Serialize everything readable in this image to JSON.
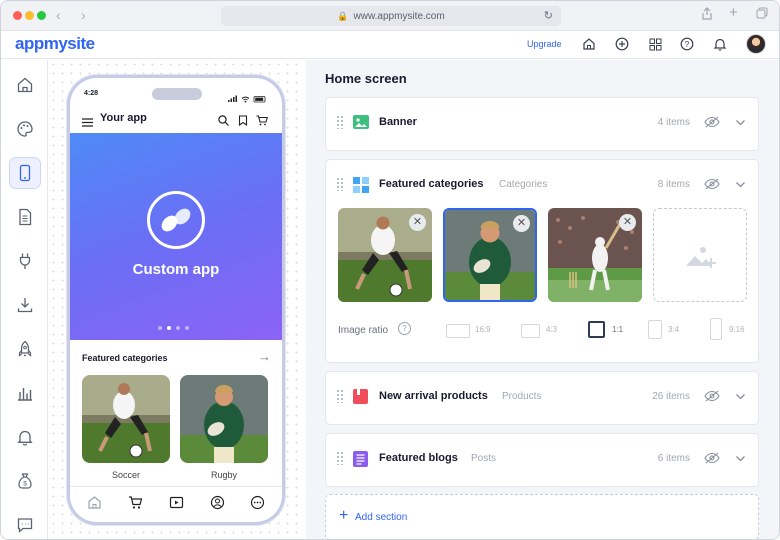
{
  "browser": {
    "url": "www.appmysite.com"
  },
  "appbar": {
    "logo": "appmysite",
    "upgrade_label": "Upgrade",
    "icons": [
      "home-icon",
      "plus-circle-icon",
      "grid-icon",
      "help-icon",
      "bell-icon"
    ]
  },
  "sidebar": {
    "items": [
      "home-icon",
      "palette-icon",
      "phone-icon",
      "document-icon",
      "plug-icon",
      "download-icon",
      "rocket-icon",
      "chart-icon",
      "bell-icon",
      "money-bag-icon",
      "chat-icon"
    ],
    "active_index": 2
  },
  "phone": {
    "time": "4:28",
    "app_title": "Your app",
    "banner_text": "Custom app",
    "section_title": "Featured categories",
    "categories": [
      {
        "label": "Soccer"
      },
      {
        "label": "Rugby"
      }
    ],
    "tabs": [
      "home-icon",
      "cart-icon",
      "play-icon",
      "profile-icon",
      "more-icon"
    ]
  },
  "main": {
    "title": "Home screen",
    "sections": [
      {
        "title": "Banner",
        "subtitle": "",
        "count": "4 items",
        "icon_color": "#3fbf7f"
      },
      {
        "title": "Featured categories",
        "subtitle": "Categories",
        "count": "8 items",
        "icon_color": "#3ea6f2"
      },
      {
        "title": "New arrival products",
        "subtitle": "Products",
        "count": "26 items",
        "icon_color": "#f04d5c"
      },
      {
        "title": "Featured blogs",
        "subtitle": "Posts",
        "count": "6 items",
        "icon_color": "#8a5cf0"
      }
    ],
    "image_ratio_label": "Image ratio",
    "ratios": [
      "16:9",
      "4:3",
      "1:1",
      "3:4",
      "9:16"
    ],
    "selected_ratio": "1:1",
    "add_section_label": "Add section"
  },
  "colors": {
    "accent": "#3064f2"
  }
}
